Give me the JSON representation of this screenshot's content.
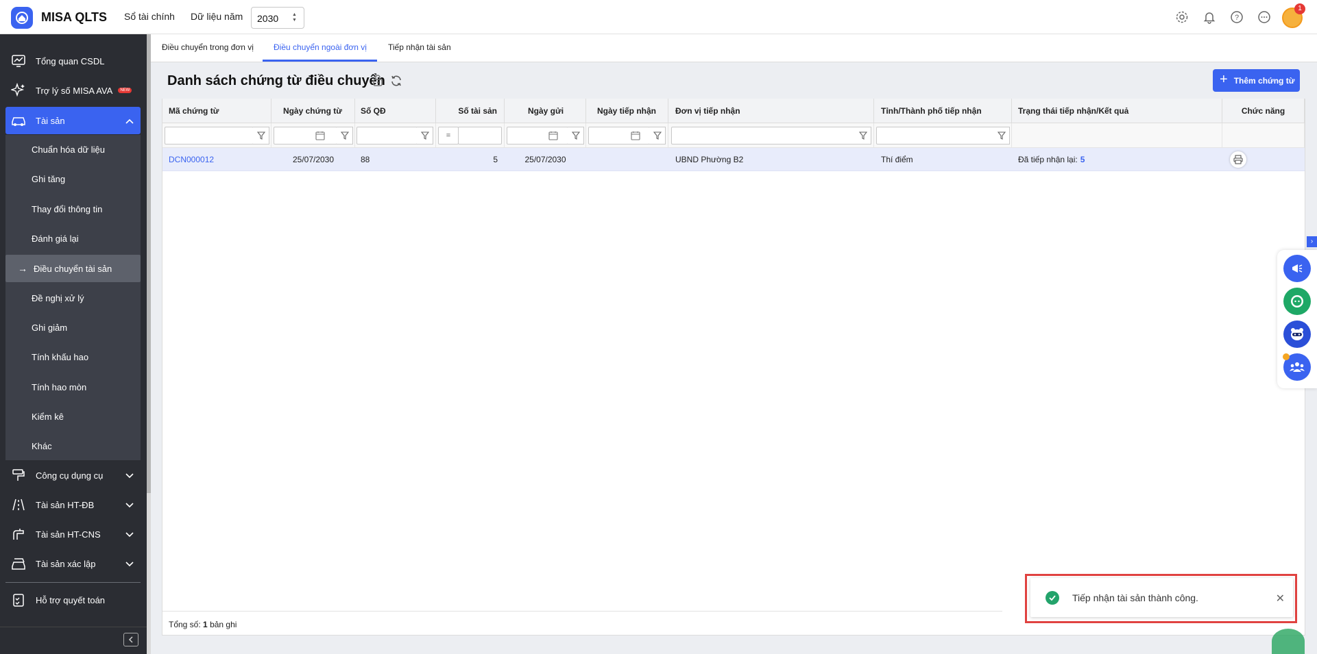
{
  "app": {
    "name": "MISA QLTS"
  },
  "topbar": {
    "so_tai_chinh": "Sổ tài chính",
    "du_lieu_nam_label": "Dữ liệu năm",
    "year_value": "2030",
    "notification_count": "1"
  },
  "sidebar": {
    "items": [
      {
        "label": "Tổng quan CSDL",
        "icon": "monitor-chart-icon"
      },
      {
        "label": "Trợ lý số MISA AVA",
        "icon": "sparkle-icon",
        "badge": "NEW"
      },
      {
        "label": "Tài sản",
        "icon": "car-icon"
      },
      {
        "label": "Công cụ dụng cụ",
        "icon": "paint-roller-icon"
      },
      {
        "label": "Tài sản HT-ĐB",
        "icon": "road-icon"
      },
      {
        "label": "Tài sản HT-CNS",
        "icon": "faucet-icon"
      },
      {
        "label": "Tài sản xác lập",
        "icon": "car-stack-icon"
      },
      {
        "label": "Hỗ trợ quyết toán",
        "icon": "clipboard-check-icon"
      }
    ],
    "submenu": [
      "Chuẩn hóa dữ liệu",
      "Ghi tăng",
      "Thay đổi thông tin",
      "Đánh giá lại",
      "Điều chuyển tài sản",
      "Đề nghị xử lý",
      "Ghi giảm",
      "Tính khấu hao",
      "Tính hao mòn",
      "Kiểm kê",
      "Khác"
    ]
  },
  "tabs": [
    "Điều chuyển trong đơn vị",
    "Điều chuyển ngoài đơn vị",
    "Tiếp nhận tài sản"
  ],
  "page": {
    "title": "Danh sách chứng từ điều chuyển",
    "add_button": "Thêm chứng từ"
  },
  "table": {
    "columns": [
      "Mã chứng từ",
      "Ngày chứng từ",
      "Số QĐ",
      "Số tài sản",
      "Ngày gửi",
      "Ngày tiếp nhận",
      "Đơn vị tiếp nhận",
      "Tỉnh/Thành phố tiếp nhận",
      "Trạng thái tiếp nhận/Kết quả",
      "Chức năng"
    ],
    "filter_operator": "=",
    "rows": [
      {
        "ma_chung_tu": "DCN000012",
        "ngay_chung_tu": "25/07/2030",
        "so_qd": "88",
        "so_tai_san": "5",
        "ngay_gui": "25/07/2030",
        "ngay_tiep_nhan": "",
        "don_vi_tiep_nhan": "UBND Phường B2",
        "tinh_thanh_pho": "Thí điểm",
        "trang_thai_label": "Đã tiếp nhận lại:",
        "trang_thai_count": "5"
      }
    ],
    "total_label": "Tổng số:",
    "total_count": "1",
    "total_suffix": "bản ghi"
  },
  "toast": {
    "message": "Tiếp nhận tài sản thành công."
  },
  "colors": {
    "accent": "#3a63f0",
    "sidebar": "#2b2d33",
    "success": "#23a36b",
    "highlight_frame": "#e04240"
  }
}
